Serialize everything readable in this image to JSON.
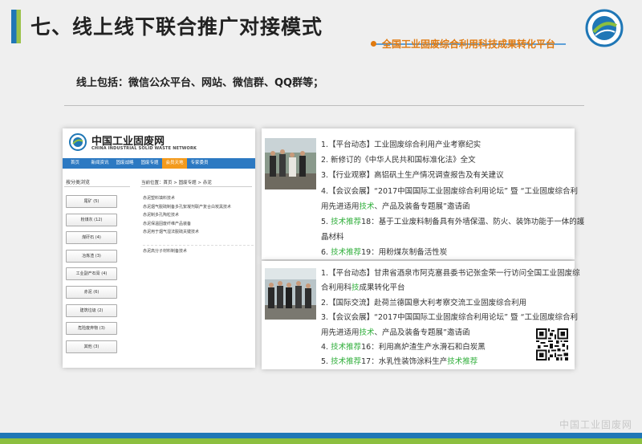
{
  "slide": {
    "title": "七、线上线下联合推广对接模式",
    "subtitle": "全国工业固废综合利用科技成果转化平台",
    "intro": "线上包括：微信公众平台、网站、微信群、QQ群等；",
    "watermark": "中国工业固废网",
    "accent_colors": {
      "blue": "#1f77b6",
      "green": "#8cbf3f",
      "orange": "#e07a10"
    }
  },
  "site": {
    "name": "中国工业固废网",
    "name_en": "CHINA INDUSTRIAL SOLID WASTE NETWORK",
    "nav": [
      "首页",
      "新闻资讯",
      "固废战略",
      "固废专题",
      "会员天地",
      "专家委员"
    ],
    "nav_active": "会员天地",
    "category_title": "按分类浏览",
    "categories": [
      "尾矿 (5)",
      "粉煤灰 (12)",
      "煤矸石 (4)",
      "冶炼渣 (3)",
      "工业副产石膏 (4)",
      "赤泥 (6)",
      "建筑垃圾 (2)",
      "危险废弃物 (3)",
      "其他 (3)"
    ],
    "breadcrumb": "当前位置：首页 > 固废专题 > 赤泥",
    "articles": [
      "赤泥塑料填料技术",
      "赤泥烟气脱硫制备多孔絮凝剂联产复合白炭黑技术",
      "赤泥制多孔陶粒技术",
      "赤泥保温固废纤维产品装备",
      "赤泥用于烟气湿法脱硫关键技术",
      "赤泥高分子材料制备技术"
    ]
  },
  "news1": {
    "lines": [
      {
        "pre": "1.【平台动态】工业固废综合利用产业考察纪实",
        "tag": "",
        "post": ""
      },
      {
        "pre": "2. 新修订的《中华人民共和国标准化法》全文",
        "tag": "",
        "post": ""
      },
      {
        "pre": "3.【行业观察】高铝矾土生产情况调查报告及有关建议",
        "tag": "",
        "post": ""
      },
      {
        "pre": "4.【会议会展】“2017中国国际工业固废综合利用论坛” 暨 “工业固废综合利",
        "tag": "",
        "post": ""
      },
      {
        "pre": "用先进适用",
        "tag": "技术",
        "post": "、产品及装备专题展”邀请函"
      },
      {
        "pre": "5. ",
        "tag": "技术推荐",
        "post": "18：基于工业废料制备具有外墙保温、防火、装饰功能于一体的護"
      },
      {
        "pre": "晶材料",
        "tag": "",
        "post": ""
      },
      {
        "pre": "6. ",
        "tag": "技术推荐",
        "post": "19：用粉煤灰制备活性炭"
      }
    ]
  },
  "news2": {
    "lines": [
      {
        "pre": "1.【平台动态】甘肃省酒泉市阿克塞县委书记张金荣一行访问全国工业固废综",
        "tag": "",
        "post": ""
      },
      {
        "pre": "合利用科",
        "tag": "技",
        "post": "成果转化平台"
      },
      {
        "pre": "2.【国际交流】赴荷兰德国意大利考察交流工业固废综合利用",
        "tag": "",
        "post": ""
      },
      {
        "pre": "3.【会议会展】“2017中国国际工业固废综合利用论坛” 暨 “工业固废综合利",
        "tag": "",
        "post": ""
      },
      {
        "pre": "用先进适用",
        "tag": "技术",
        "post": "、产品及装备专题展”邀请函"
      },
      {
        "pre": "4. ",
        "tag": "技术推荐",
        "post": "16：利用高炉渣生产水滑石和白炭黑"
      },
      {
        "pre": "5. ",
        "tag": "技术推荐",
        "post": "17：水乳性装饰涂料生产"
      },
      {
        "pre": "",
        "tag": "",
        "post": ""
      }
    ],
    "line5_tail": "技术推荐"
  }
}
